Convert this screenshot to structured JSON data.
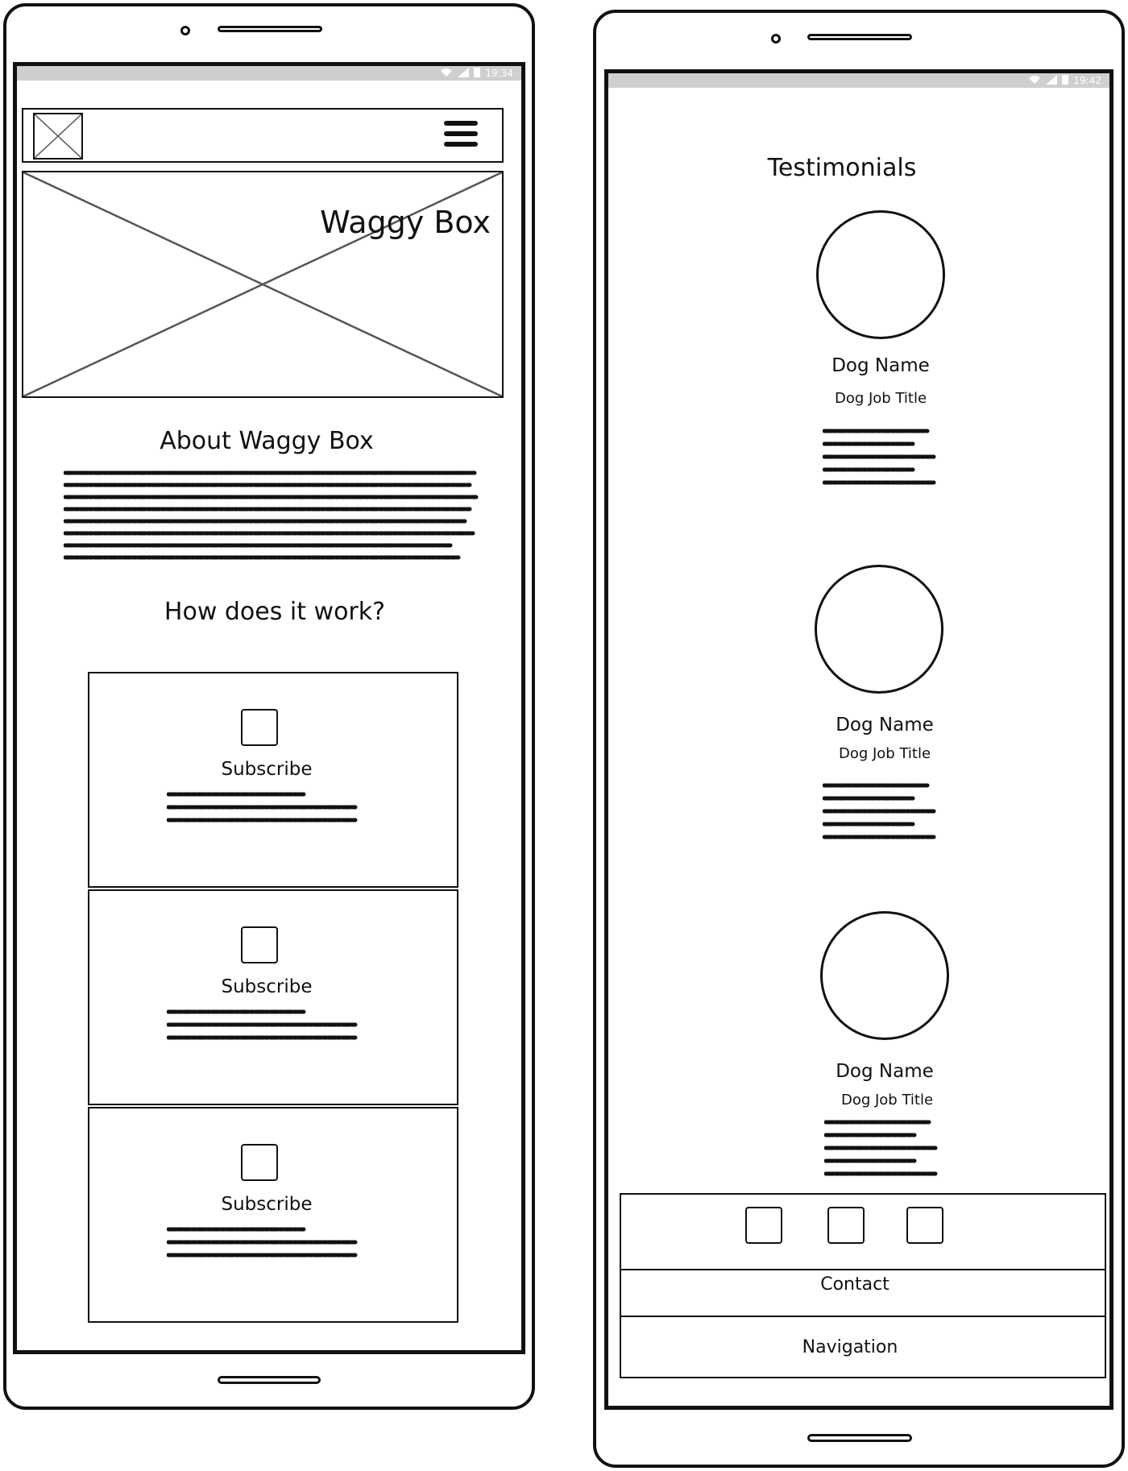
{
  "left_phone": {
    "status_time": "19:34",
    "header": {
      "logo_icon": "image-placeholder-icon",
      "menu_icon": "hamburger-menu-icon"
    },
    "hero": {
      "title": "Waggy Box"
    },
    "about": {
      "title": "About Waggy Box"
    },
    "how": {
      "title": "How does it work?"
    },
    "cards": [
      {
        "title": "Subscribe",
        "icon": "square-icon"
      },
      {
        "title": "Subscribe",
        "icon": "square-icon"
      },
      {
        "title": "Subscribe",
        "icon": "square-icon"
      }
    ]
  },
  "right_phone": {
    "status_time": "19:42",
    "testimonials": {
      "title": "Testimonials",
      "items": [
        {
          "name": "Dog Name",
          "job": "Dog Job Title"
        },
        {
          "name": "Dog Name",
          "job": "Dog Job Title"
        },
        {
          "name": "Dog Name",
          "job": "Dog Job Title"
        }
      ]
    },
    "footer": {
      "social_icons": [
        "square-icon",
        "square-icon",
        "square-icon"
      ],
      "contact": "Contact",
      "navigation": "Navigation"
    }
  }
}
